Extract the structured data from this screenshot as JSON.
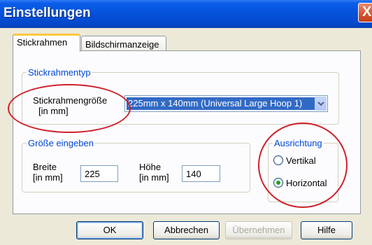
{
  "window": {
    "title": "Einstellungen",
    "close_glyph": "X"
  },
  "tabs": [
    {
      "label": "Stickrahmen",
      "active": true
    },
    {
      "label": "Bildschirmanzeige",
      "active": false
    }
  ],
  "hoop_group": {
    "legend": "Stickrahmentyp",
    "size_label_line1": "Stickrahmengröße",
    "size_label_line2": "[in mm]",
    "selected_hoop": "225mm x 140mm (Universal Large Hoop 1)"
  },
  "size_group": {
    "legend": "Größe eingeben",
    "width_label_line1": "Breite",
    "width_label_line2": "[in mm]",
    "width_value": "225",
    "height_label_line1": "Höhe",
    "height_label_line2": "[in mm]",
    "height_value": "140"
  },
  "orientation_group": {
    "legend": "Ausrichtung",
    "options": [
      {
        "label": "Vertikal",
        "checked": false
      },
      {
        "label": "Horizontal",
        "checked": true
      }
    ]
  },
  "buttons": {
    "ok": "OK",
    "cancel": "Abbrechen",
    "apply": "Übernehmen",
    "help": "Hilfe"
  },
  "annotation_color": "#d0202a",
  "icons": {
    "dropdown": "chevron-down-icon",
    "close": "close-icon"
  }
}
